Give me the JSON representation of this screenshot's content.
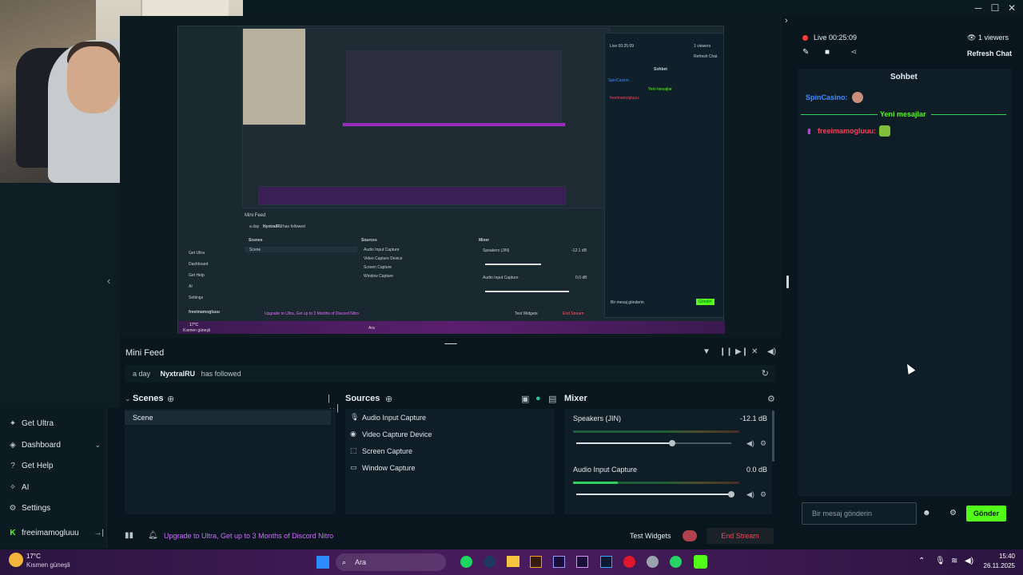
{
  "window": {
    "minimize": "─",
    "maximize": "☐",
    "close": "✕"
  },
  "stream": {
    "live_label": "Live",
    "live_time": "00:25:09",
    "viewers": "1 viewers",
    "refresh_chat": "Refresh Chat"
  },
  "chat": {
    "title": "Sohbet",
    "messages": [
      {
        "user": "SpinCasino:",
        "color": "#3f8cff"
      },
      {
        "user": "freeimamogluuu:",
        "color": "#ff3d5a"
      }
    ],
    "new_messages": "Yeni mesajlar",
    "input_placeholder": "Bir mesaj gönderin",
    "send": "Gönder"
  },
  "sidebar": {
    "items": [
      {
        "label": "Get Ultra",
        "icon": "ultra-icon"
      },
      {
        "label": "Dashboard",
        "icon": "dashboard-icon"
      },
      {
        "label": "Get Help",
        "icon": "help-icon"
      },
      {
        "label": "AI",
        "icon": "ai-icon"
      },
      {
        "label": "Settings",
        "icon": "settings-icon"
      }
    ],
    "user": "freeimamogluuu"
  },
  "minifeed": {
    "title": "Mini Feed",
    "time": "a day",
    "user": "NyxtralRU",
    "action": "has followed"
  },
  "scenes": {
    "title": "Scenes",
    "items": [
      "Scene"
    ]
  },
  "sources": {
    "title": "Sources",
    "items": [
      "Audio Input Capture",
      "Video Capture Device",
      "Screen Capture",
      "Window Capture"
    ]
  },
  "mixer": {
    "title": "Mixer",
    "channels": [
      {
        "name": "Speakers (JIN)",
        "db": "-12.1 dB",
        "level": 0.62
      },
      {
        "name": "Audio Input Capture",
        "db": "0.0 dB",
        "level": 0.27
      }
    ]
  },
  "statusbar": {
    "promo": "Upgrade to Ultra, Get up to 3 Months of Discord Nitro",
    "test_widgets": "Test Widgets",
    "end_stream": "End Stream"
  },
  "preview_mini": {
    "minifeed": "Mini Feed",
    "feed_time": "a day",
    "feed_user": "NyxtralRU",
    "feed_action": "has followed",
    "scenes": "Scenes",
    "scene": "Scene",
    "sources": "Sources",
    "mixer": "Mixer",
    "src1": "Audio Input Capture",
    "src2": "Video Capture Device",
    "src3": "Screen Capture",
    "src4": "Window Capture",
    "speakers": "Speakers (JIN)",
    "speakers_db": "-12.1 dB",
    "aic": "Audio Input Capture",
    "aic_db": "0.0 dB",
    "chat_title": "Sohbet",
    "chat_user": "SpinCasino:",
    "chat_new": "Yeni mesajlar",
    "chat_user2": "freeimamogluuu:",
    "chat_input": "Bir mesaj gönderin",
    "chat_send": "Gönder",
    "live": "Live 00:25:09",
    "viewers": "1 viewers",
    "refresh": "Refresh Chat",
    "side1": "Get Ultra",
    "side2": "Dashboard",
    "side3": "Get Help",
    "side4": "AI",
    "side5": "Settings",
    "side_user": "freeimamogluuu",
    "promo": "Upgrade to Ultra, Get up to 3 Months of Discord Nitro",
    "test_widgets": "Test Widgets",
    "end_stream": "End Stream",
    "weather_temp": "17°C",
    "weather_desc": "Kısmen güneşli",
    "search": "Ara"
  },
  "taskbar": {
    "weather_temp": "17°C",
    "weather_desc": "Kısmen güneşli",
    "search": "Ara",
    "time": "15:40",
    "date": "26.11.2025"
  }
}
